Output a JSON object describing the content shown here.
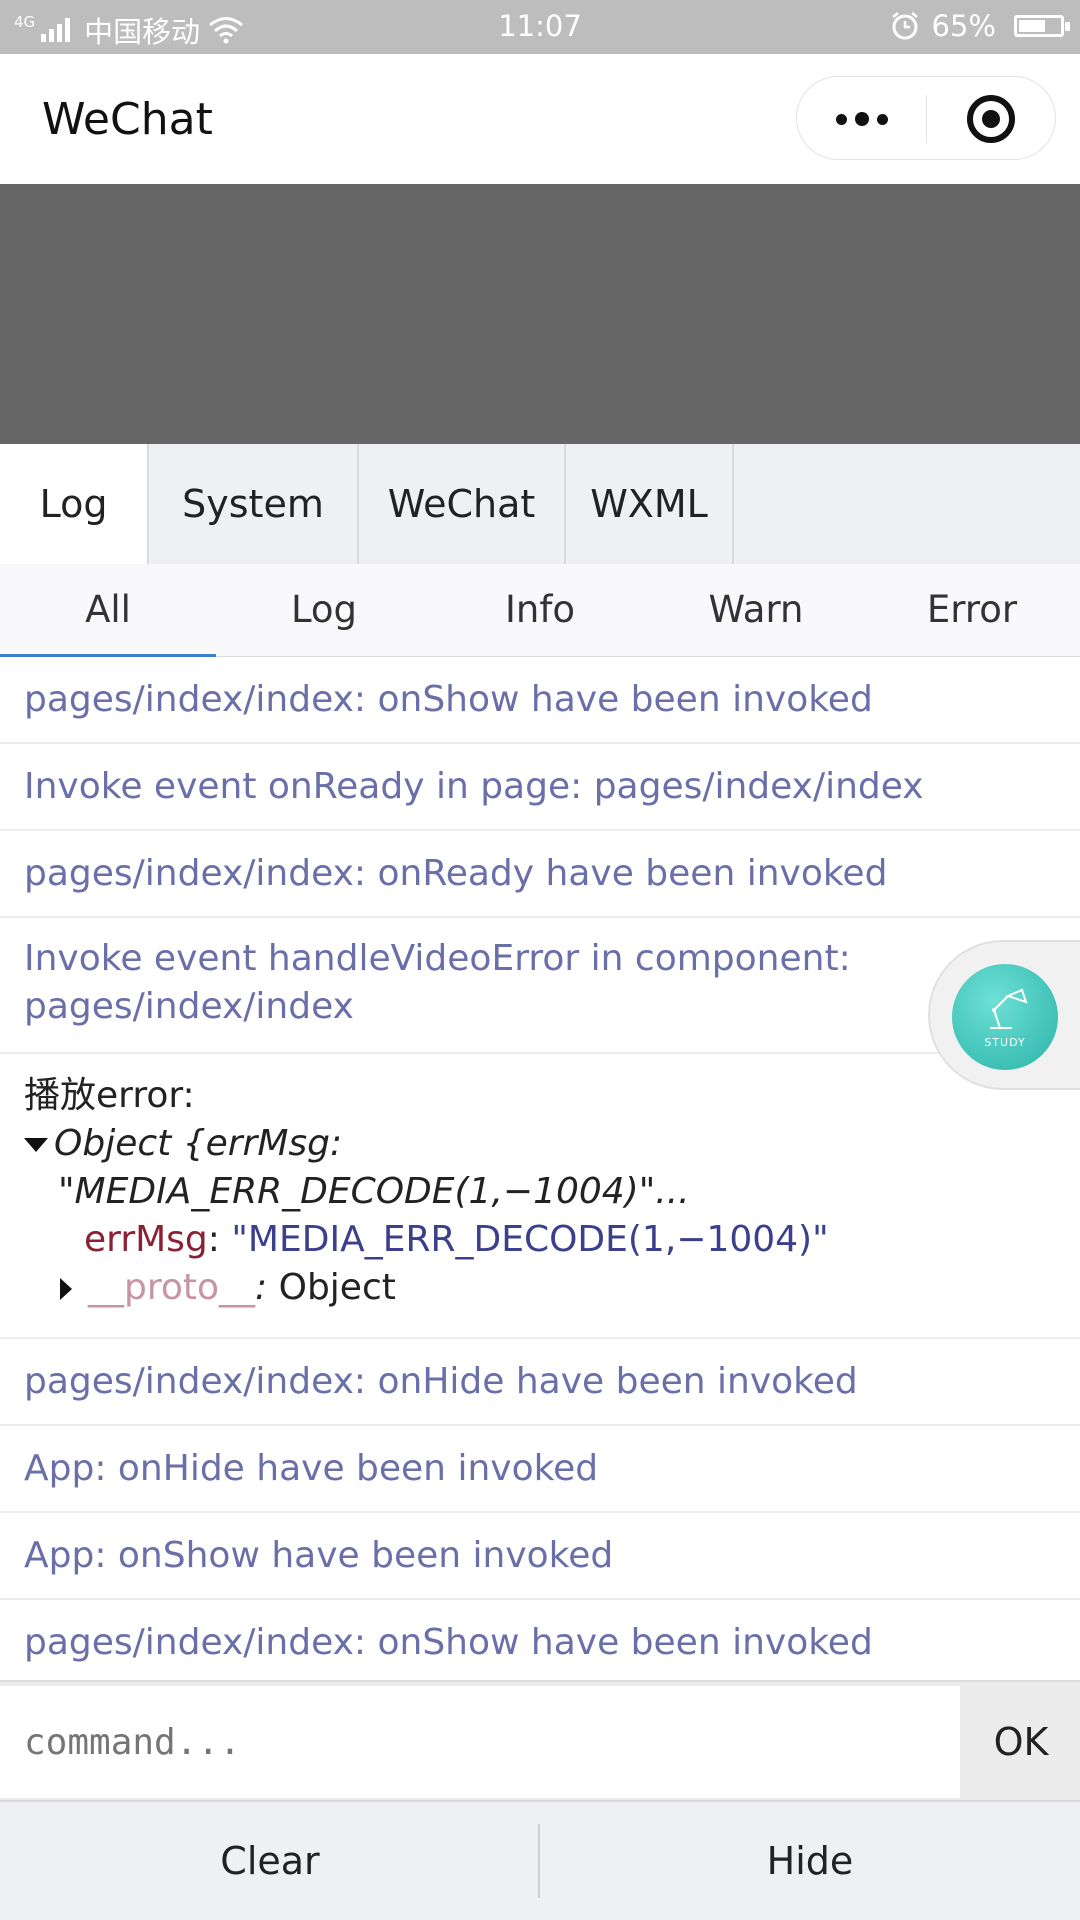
{
  "status_bar": {
    "network": "4G",
    "carrier": "中国移动",
    "time": "11:07",
    "battery": "65%",
    "battery_level": 0.65
  },
  "navbar": {
    "title": "WeChat"
  },
  "tabs": [
    {
      "label": "Log"
    },
    {
      "label": "System"
    },
    {
      "label": "WeChat"
    },
    {
      "label": "WXML"
    }
  ],
  "subtabs": [
    {
      "label": "All"
    },
    {
      "label": "Log"
    },
    {
      "label": "Info"
    },
    {
      "label": "Warn"
    },
    {
      "label": "Error"
    }
  ],
  "logs": {
    "l1": "pages/index/index: onShow have been invoked",
    "l2": "Invoke event onReady in page: pages/index/index",
    "l3": "pages/index/index: onReady have been invoked",
    "l4a": "Invoke event handleVideoError in component:",
    "l4b": "pages/index/index",
    "error_title": "播放error:",
    "obj_head_1": "Object {errMsg:",
    "obj_head_2": "\"MEDIA_ERR_DECODE(1,−1004)\"...",
    "err_key": "errMsg",
    "err_value": "\"MEDIA_ERR_DECODE(1,−1004)\"",
    "proto_key": "__proto__",
    "proto_value": "Object",
    "l6": "pages/index/index: onHide have been invoked",
    "l7": "App: onHide have been invoked",
    "l8": "App: onShow have been invoked",
    "l9": "pages/index/index: onShow have been invoked"
  },
  "float_button": {
    "label": "STUDY"
  },
  "command": {
    "placeholder": "command...",
    "ok_label": "OK"
  },
  "bottom": {
    "clear": "Clear",
    "hide": "Hide"
  },
  "colors": {
    "log_text": "#6a6faa",
    "active_underline": "#3b7fd1",
    "video_bg": "#666666"
  }
}
